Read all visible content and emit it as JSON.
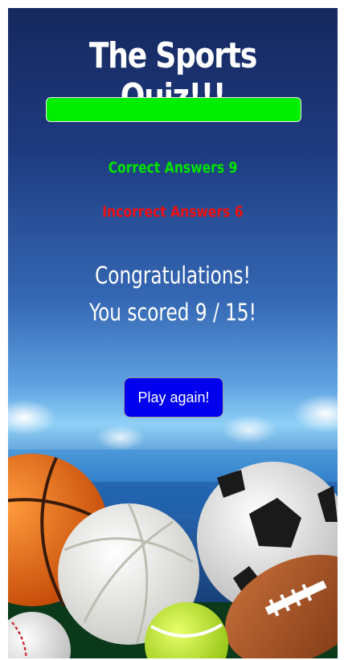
{
  "quiz": {
    "title": "The Sports Quiz!!!",
    "progress_fraction": 1.0,
    "correct_label": "Correct Answers",
    "correct_count": "9",
    "incorrect_label": "Incorrect Answers",
    "incorrect_count": "6",
    "congrats": "Congratulations!",
    "score_text": "You scored 9 / 15!",
    "play_again_label": "Play again!"
  },
  "colors": {
    "progress_fill": "#00ee00",
    "correct_text": "#00e400",
    "incorrect_text": "#ef1010",
    "button_bg": "#0000ee"
  },
  "background_image": "stadium-with-sports-balls"
}
